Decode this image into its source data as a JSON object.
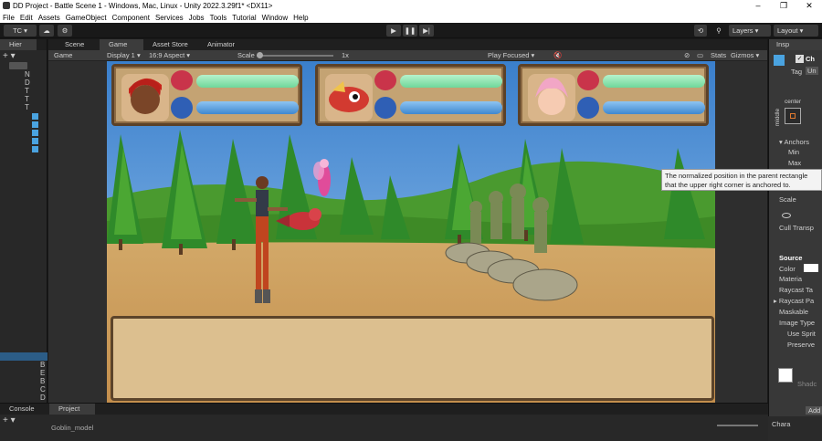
{
  "window": {
    "title": "DD Project - Battle Scene 1 - Windows, Mac, Linux - Unity 2022.3.29f1* <DX11>",
    "controls": [
      "–",
      "❐",
      "✕"
    ]
  },
  "menu": [
    "File",
    "Edit",
    "Assets",
    "GameObject",
    "Component",
    "Services",
    "Jobs",
    "Tools",
    "Tutorial",
    "Window",
    "Help"
  ],
  "toolbar": {
    "account": "TC",
    "layers": "Layers",
    "layout": "Layout"
  },
  "tabs": {
    "hierarchy": "Hier",
    "scene": "Scene",
    "game": "Game",
    "asset_store": "Asset Store",
    "animator": "Animator",
    "inspector": "Insp",
    "console": "Console",
    "project": "Project"
  },
  "gamebar": {
    "mode": "Game",
    "display": "Display 1",
    "aspect": "16:9 Aspect",
    "scale_label": "Scale",
    "scale_value": "1x",
    "play_focused": "Play Focused",
    "stats": "Stats",
    "gizmos": "Gizmos"
  },
  "hierarchy": {
    "letters": [
      "N",
      "D",
      "T",
      "T",
      "T",
      "B",
      "E",
      "B",
      "C",
      "D"
    ]
  },
  "inspector": {
    "name": "Ch",
    "tag": "Tag",
    "tag_value": "Un",
    "anchor_center": "center",
    "anchor_middle": "middle",
    "anchors": "Anchors",
    "min": "Min",
    "max": "Max",
    "scale": "Scale",
    "cull": "Cull Transp",
    "source": "Source",
    "color": "Color",
    "material": "Materia",
    "raycast_target": "Raycast Ta",
    "raycast_padding": "Raycast Pa",
    "maskable": "Maskable",
    "image_type": "Image Type",
    "use_sprite": "Use Sprit",
    "preserve": "Preserve",
    "shadow": "Shadc",
    "add": "Add",
    "bottom_label": "Chara"
  },
  "tooltip": {
    "text": "The normalized position in the parent rectangle that the upper right corner is anchored to."
  },
  "console": {
    "item": "Goblin_model"
  },
  "colors": {
    "health": "#6fd79a",
    "mana": "#3f88cf",
    "sky": "#3b86cd",
    "sand": "#c79b59",
    "grass": "#3e8a26"
  }
}
